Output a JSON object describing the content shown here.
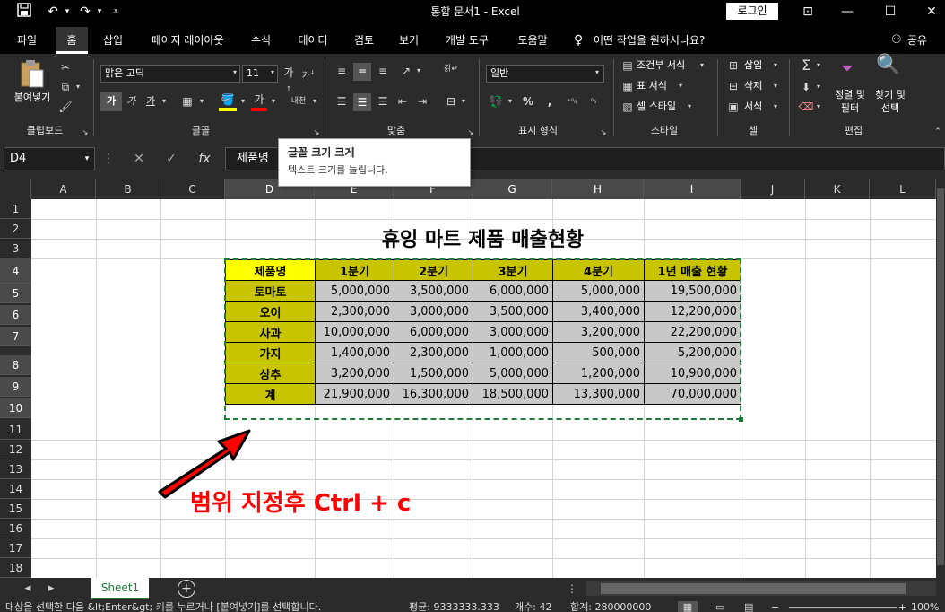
{
  "window": {
    "title": "통합 문서1  -  Excel",
    "login": "로그인"
  },
  "menu": {
    "items": [
      "파일",
      "홈",
      "삽입",
      "페이지 레이아웃",
      "수식",
      "데이터",
      "검토",
      "보기",
      "개발 도구",
      "도움말"
    ],
    "search": "어떤 작업을 원하시나요?",
    "share": "공유"
  },
  "ribbon": {
    "paste_label": "붙여넣기",
    "font_name": "맑은 고딕",
    "font_size": "11",
    "number_format": "일반",
    "conditional": "조건부 서식",
    "table_format": "표 서식",
    "cell_style": "셀 스타일",
    "insert": "삽입",
    "delete": "삭제",
    "format": "서식",
    "sort_filter": "정렬 및\n필터",
    "find_select": "찾기 및\n선택",
    "groups": [
      "클립보드",
      "글꼴",
      "맞춤",
      "표시 형식",
      "스타일",
      "셀",
      "편집"
    ]
  },
  "formula_bar": {
    "namebox": "D4",
    "content": "제품명"
  },
  "tooltip": {
    "title": "글꼴 크기 크게",
    "desc": "텍스트 크기를 늘립니다."
  },
  "columns": [
    "A",
    "B",
    "C",
    "D",
    "E",
    "F",
    "G",
    "H",
    "I",
    "J",
    "K",
    "L"
  ],
  "rows": [
    "1",
    "2",
    "3",
    "4",
    "5",
    "6",
    "7",
    "8",
    "9",
    "10",
    "11",
    "12",
    "13",
    "14",
    "15",
    "16",
    "17",
    "18"
  ],
  "sheet_title": "휴잉 마트 제품 매출현황",
  "table": {
    "headers": [
      "제품명",
      "1분기",
      "2분기",
      "3분기",
      "4분기",
      "1년 매출 현황"
    ],
    "rows": [
      [
        "토마토",
        "5,000,000",
        "3,500,000",
        "6,000,000",
        "5,000,000",
        "19,500,000"
      ],
      [
        "오이",
        "2,300,000",
        "3,000,000",
        "3,500,000",
        "3,400,000",
        "12,200,000"
      ],
      [
        "사과",
        "10,000,000",
        "6,000,000",
        "3,000,000",
        "3,200,000",
        "22,200,000"
      ],
      [
        "가지",
        "1,400,000",
        "2,300,000",
        "1,000,000",
        "500,000",
        "5,200,000"
      ],
      [
        "상추",
        "3,200,000",
        "1,500,000",
        "5,000,000",
        "1,200,000",
        "10,900,000"
      ],
      [
        "계",
        "21,900,000",
        "16,300,000",
        "18,500,000",
        "13,300,000",
        "70,000,000"
      ]
    ]
  },
  "annotation": "범위 지정후 Ctrl + c",
  "sheet_tab": "Sheet1",
  "status": {
    "message": "대상을 선택한 다음 &lt;Enter&gt; 키를 누르거나 [붙여넣기]를 선택합니다.",
    "average": "평균: 9333333.333",
    "count": "개수: 42",
    "sum": "합계: 280000000",
    "zoom": "100%"
  }
}
